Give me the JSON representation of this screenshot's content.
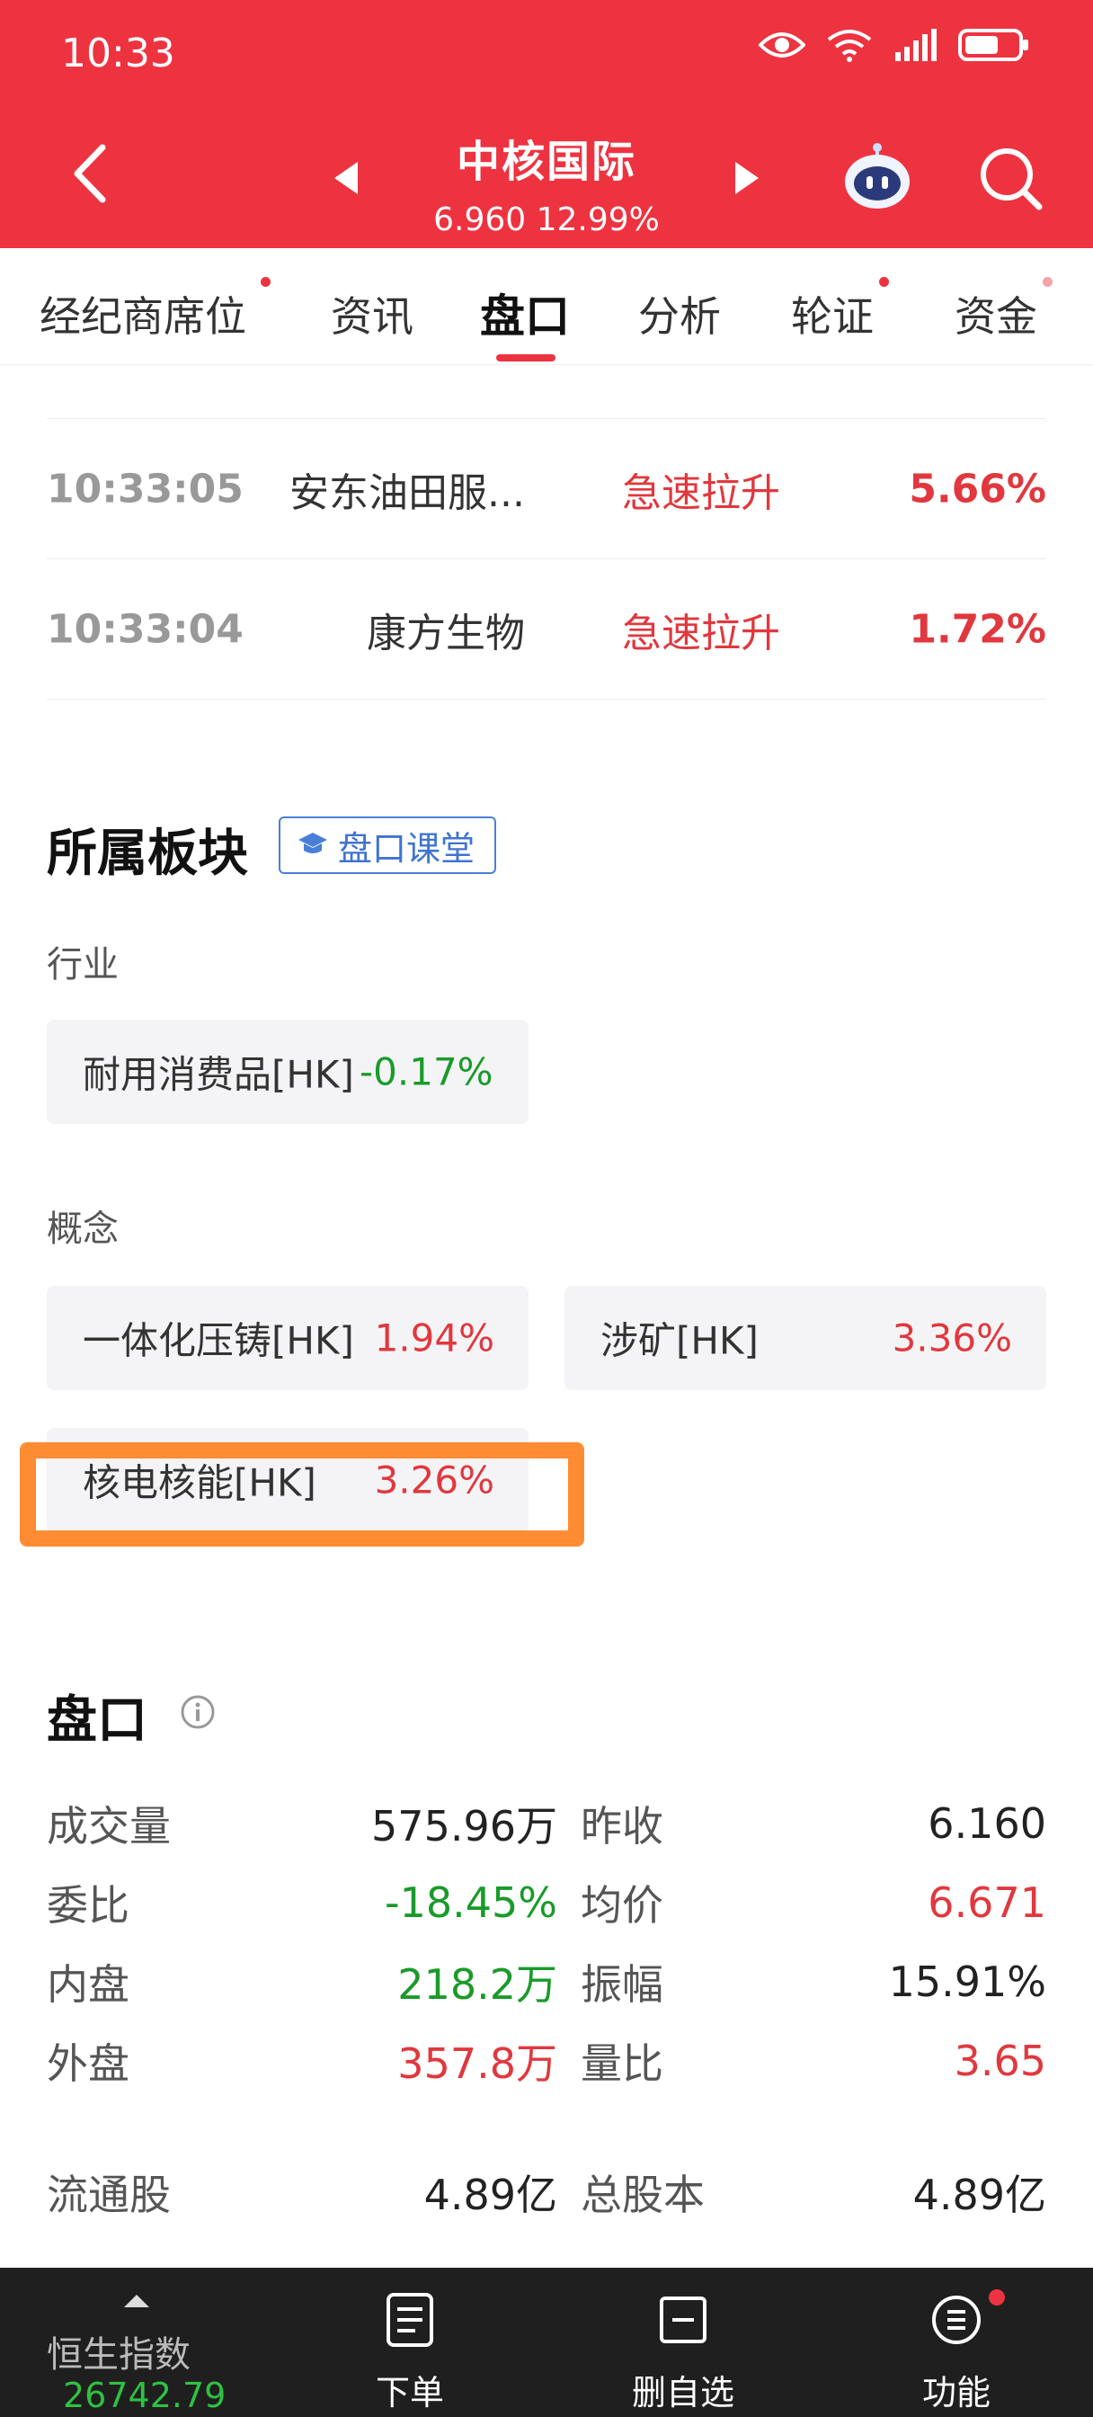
{
  "status_bar": {
    "time": "10:33"
  },
  "header": {
    "stock_name": "中核国际",
    "price": "6.960",
    "change_pct": "12.99%"
  },
  "tabs": [
    {
      "label": "经纪商席位",
      "dot": true
    },
    {
      "label": "资讯",
      "dot": false
    },
    {
      "label": "盘口",
      "dot": false,
      "active": true
    },
    {
      "label": "分析",
      "dot": false
    },
    {
      "label": "轮证",
      "dot": true
    },
    {
      "label": "资金",
      "dot": true
    }
  ],
  "alerts": [
    {
      "time": "10:33:05",
      "name": "安东油田服...",
      "type": "急速拉升",
      "pct": "5.66%"
    },
    {
      "time": "10:33:04",
      "name": "康方生物",
      "type": "急速拉升",
      "pct": "1.72%"
    }
  ],
  "sectors": {
    "title": "所属板块",
    "course_badge": "盘口课堂",
    "industry_label": "行业",
    "industry": [
      {
        "name": "耐用消费品[HK]",
        "pct": "-0.17%",
        "direction": "down"
      }
    ],
    "concept_label": "概念",
    "concepts": [
      {
        "name": "一体化压铸[HK]",
        "pct": "1.94%",
        "direction": "up"
      },
      {
        "name": "涉矿[HK]",
        "pct": "3.36%",
        "direction": "up"
      },
      {
        "name": "核电核能[HK]",
        "pct": "3.26%",
        "direction": "up"
      }
    ]
  },
  "quote": {
    "title": "盘口",
    "rows": [
      {
        "l1": "成交量",
        "v1": "575.96万",
        "c1": "neutral",
        "l2": "昨收",
        "v2": "6.160",
        "c2": "neutral"
      },
      {
        "l1": "委比",
        "v1": "-18.45%",
        "c1": "green",
        "l2": "均价",
        "v2": "6.671",
        "c2": "red"
      },
      {
        "l1": "内盘",
        "v1": "218.2万",
        "c1": "green",
        "l2": "振幅",
        "v2": "15.91%",
        "c2": "neutral"
      },
      {
        "l1": "外盘",
        "v1": "357.8万",
        "c1": "red",
        "l2": "量比",
        "v2": "3.65",
        "c2": "red"
      },
      {
        "l1": "流通股",
        "v1": "4.89亿",
        "c1": "neutral",
        "l2": "总股本",
        "v2": "4.89亿",
        "c2": "neutral"
      }
    ]
  },
  "bottom_bar": {
    "index_name": "恒生指数",
    "index_value": "26742.79",
    "order_label": "下单",
    "remove_watch_label": "删自选",
    "function_label": "功能"
  },
  "colors": {
    "brand_red": "#ee3340",
    "up": "#e0383e",
    "down": "#1a9a2a",
    "highlight": "#ff8c33"
  }
}
